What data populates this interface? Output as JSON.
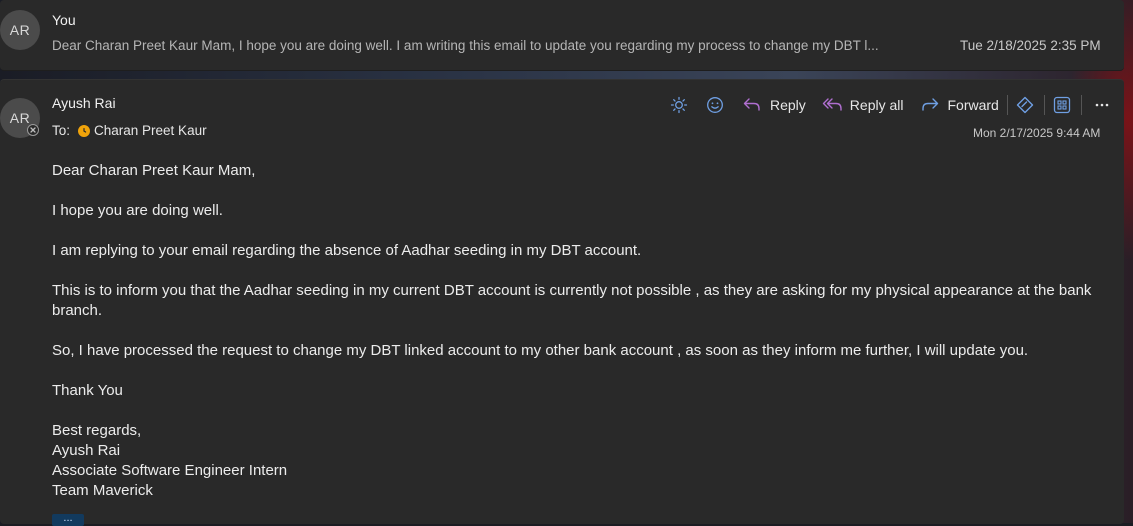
{
  "collapsed_message": {
    "avatar_initials": "AR",
    "sender": "You",
    "preview": "Dear Charan Preet Kaur Mam, I hope you are doing well. I am writing this email to update you regarding my process to change my DBT l...",
    "date": "Tue 2/18/2025 2:35 PM"
  },
  "message": {
    "avatar_initials": "AR",
    "sender": "Ayush Rai",
    "to_label": "To:",
    "recipient": "Charan Preet Kaur",
    "date": "Mon 2/17/2025 9:44 AM",
    "toolbar": {
      "reply_label": "Reply",
      "reply_all_label": "Reply all",
      "forward_label": "Forward"
    },
    "body": {
      "greeting": "Dear Charan Preet Kaur Mam,",
      "line1": "I hope you are doing well.",
      "line2": "I am replying to your email regarding the absence of Aadhar seeding in my DBT account.",
      "line3": "This is to inform you that the Aadhar seeding in my current DBT account is currently not possible , as they are asking for my physical appearance at the bank branch.",
      "line4": "So, I have processed the request to change my DBT linked account to my other bank account , as soon as they inform me further, I will update you.",
      "thanks": "Thank You",
      "regards": "Best regards,",
      "sig_name": "Ayush Rai",
      "sig_title": "Associate Software Engineer Intern",
      "sig_team": "Team Maverick"
    },
    "more_label": "..."
  },
  "colors": {
    "accent": "#6f9fe3",
    "reply_all_accent": "#b06fd0",
    "recipient_dot": "#f0a30a"
  },
  "icons": [
    "sun-icon",
    "emoji-icon",
    "reply-icon",
    "reply-all-icon",
    "forward-icon",
    "tag-icon",
    "apps-icon",
    "more-icon",
    "presence-blocked-icon"
  ]
}
